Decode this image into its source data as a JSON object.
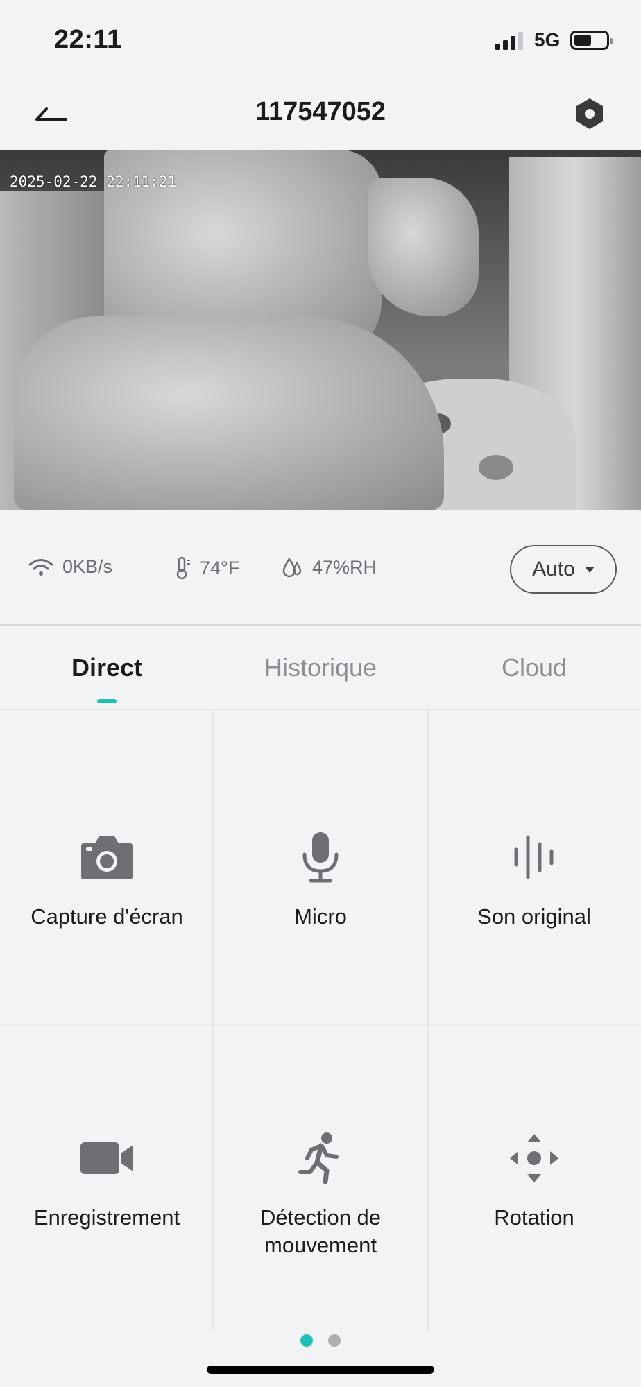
{
  "status_bar": {
    "time": "22:11",
    "network": "5G",
    "battery_level": 0.55
  },
  "header": {
    "title": "117547052"
  },
  "video": {
    "timestamp": "2025-02-22 22:11:21"
  },
  "info": {
    "speed": "0KB/s",
    "temperature": "74°F",
    "humidity": "47%RH",
    "quality": "Auto"
  },
  "tabs": [
    {
      "label": "Direct",
      "active": true
    },
    {
      "label": "Historique",
      "active": false
    },
    {
      "label": "Cloud",
      "active": false
    }
  ],
  "actions": [
    {
      "label": "Capture d'écran",
      "icon": "camera-icon"
    },
    {
      "label": "Micro",
      "icon": "microphone-icon"
    },
    {
      "label": "Son original",
      "icon": "sound-wave-icon"
    },
    {
      "label": "Enregistrement",
      "icon": "video-record-icon"
    },
    {
      "label": "Détection de mouvement",
      "icon": "running-person-icon"
    },
    {
      "label": "Rotation",
      "icon": "direction-pad-icon"
    }
  ],
  "pager": {
    "pages": 2,
    "current": 1
  },
  "colors": {
    "accent": "#1fc1b6",
    "icon_gray": "#6e6e73",
    "background": "#f2f3f5"
  }
}
